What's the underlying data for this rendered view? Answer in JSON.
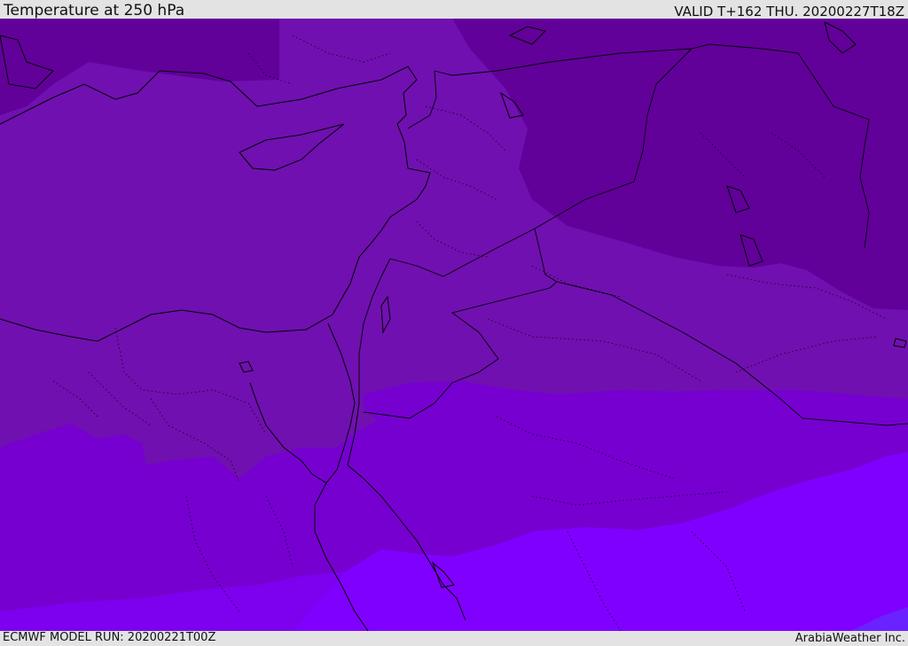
{
  "header": {
    "title": "Temperature at 250 hPa",
    "valid": "VALID T+162 THU. 20200227T18Z"
  },
  "footer": {
    "model_run": "ECMWF MODEL RUN: 20200221T00Z",
    "credit": "ArabiaWeather Inc."
  },
  "colors": {
    "band_1_darkest": "#62009a",
    "band_2": "#7010b0",
    "band_3": "#7600d0",
    "band_4": "#7d00ee",
    "band_5": "#8000ff",
    "band_6_lightest": "#6a22ff",
    "borders": "#000000"
  }
}
